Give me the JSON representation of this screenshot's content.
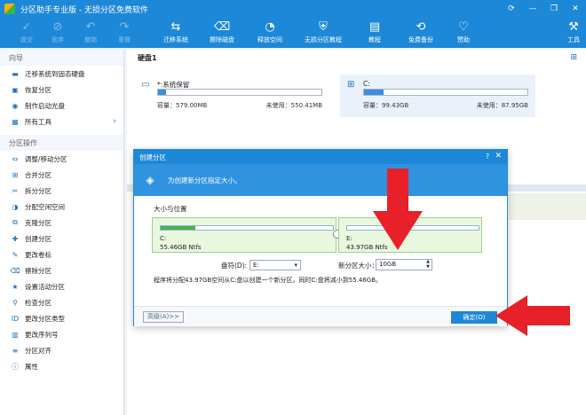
{
  "app": {
    "title": "分区助手专业版 - 无损分区免费软件",
    "window_controls": [
      "⟳",
      "—",
      "❐",
      "✕"
    ]
  },
  "toolbar": {
    "items": [
      {
        "label": "提交",
        "icon": "check-icon",
        "glyph": "✓",
        "enabled": false
      },
      {
        "label": "放弃",
        "icon": "cancel-icon",
        "glyph": "⊘",
        "enabled": false
      },
      {
        "label": "撤销",
        "icon": "undo-icon",
        "glyph": "↶",
        "enabled": false
      },
      {
        "label": "重做",
        "icon": "redo-icon",
        "glyph": "↷",
        "enabled": false
      },
      {
        "label": "迁移系统",
        "icon": "migrate-os-icon",
        "glyph": "⇆",
        "enabled": true
      },
      {
        "label": "擦除磁盘",
        "icon": "wipe-disk-icon",
        "glyph": "⌫",
        "enabled": true
      },
      {
        "label": "释放空间",
        "icon": "free-space-icon",
        "glyph": "◔",
        "enabled": true
      },
      {
        "label": "无损分区教程",
        "icon": "shield-icon",
        "glyph": "⛨",
        "enabled": true
      },
      {
        "label": "教程",
        "icon": "tutorial-icon",
        "glyph": "▤",
        "enabled": true
      },
      {
        "label": "免费备份",
        "icon": "backup-icon",
        "glyph": "⟲",
        "enabled": true
      },
      {
        "label": "赞助",
        "icon": "heart-icon",
        "glyph": "♡",
        "enabled": true
      },
      {
        "label": "工具",
        "icon": "tools-icon",
        "glyph": "⚒",
        "enabled": true
      }
    ]
  },
  "sidebar": {
    "wizard_header": "向导",
    "wizard_items": [
      {
        "label": "迁移系统到固态硬盘",
        "icon": "ssd-icon",
        "glyph": "▬"
      },
      {
        "label": "恢复分区",
        "icon": "recover-icon",
        "glyph": "▣"
      },
      {
        "label": "制作启动光盘",
        "icon": "boot-disc-icon",
        "glyph": "◉"
      },
      {
        "label": "所有工具",
        "icon": "all-tools-icon",
        "glyph": "▦",
        "has_chevron": true
      }
    ],
    "chevron": "›",
    "ops_header": "分区操作",
    "ops_items": [
      {
        "label": "调整/移动分区",
        "icon": "resize-icon",
        "glyph": "⇔"
      },
      {
        "label": "合并分区",
        "icon": "merge-icon",
        "glyph": "⊞"
      },
      {
        "label": "拆分分区",
        "icon": "split-icon",
        "glyph": "✂"
      },
      {
        "label": "分配空闲空间",
        "icon": "allocate-icon",
        "glyph": "◑"
      },
      {
        "label": "克隆分区",
        "icon": "clone-icon",
        "glyph": "⧉"
      },
      {
        "label": "创建分区",
        "icon": "create-icon",
        "glyph": "✚"
      },
      {
        "label": "更改卷标",
        "icon": "label-icon",
        "glyph": "✎"
      },
      {
        "label": "擦除分区",
        "icon": "wipe-icon",
        "glyph": "⌫"
      },
      {
        "label": "设置活动分区",
        "icon": "active-icon",
        "glyph": "★"
      },
      {
        "label": "检查分区",
        "icon": "check-partition-icon",
        "glyph": "⚲"
      },
      {
        "label": "更改分区类型",
        "icon": "type-icon",
        "glyph": "ID"
      },
      {
        "label": "更改序列号",
        "icon": "serial-icon",
        "glyph": "▥"
      },
      {
        "label": "分区对齐",
        "icon": "align-icon",
        "glyph": "≡"
      },
      {
        "label": "属性",
        "icon": "info-icon",
        "glyph": "ⓘ"
      }
    ]
  },
  "main": {
    "disk_label": "硬盘1",
    "view_icon_glyph": "⊞",
    "partitions": [
      {
        "name": "*:系统保留",
        "capacity": "容量：579.00MB",
        "free": "未使用：550.41MB",
        "used_fraction": 0.05,
        "selected": false,
        "icon": "disk-icon",
        "glyph": "▭"
      },
      {
        "name": "C:",
        "capacity": "容量：99.43GB",
        "free": "未使用：87.95GB",
        "used_fraction": 0.12,
        "selected": true,
        "icon": "windows-icon",
        "glyph": "⊞"
      }
    ]
  },
  "dialog": {
    "title": "创建分区",
    "help": "?",
    "close": "✕",
    "banner_text": "为创建新分区指定大小。",
    "banner_glyph": "◈",
    "section_label": "大小与位置",
    "left_partition": {
      "name": "C:",
      "size": "55.46GB Ntfs",
      "used_fraction": 0.2
    },
    "right_partition": {
      "name": "E:",
      "size": "43.97GB Ntfs",
      "used_fraction": 0.0
    },
    "drive_letter_label": "盘符(D):",
    "drive_letter_value": "E:",
    "dropdown_glyph": "▾",
    "size_label": "新分区大小：",
    "size_value": "10GB",
    "spin_glyph": "▲▼",
    "note": "程序将分配43.97GB空间从C:盘以创建一个新分区。同时C:盘将减小到55.46GB。",
    "advanced_button": "高级(A)>>",
    "ok_button": "确定(O)"
  },
  "colors": {
    "titlebar": "#1d88d8",
    "accent": "#3b8fde",
    "arrow": "#e8202a",
    "partition_green": "#e9f7df"
  }
}
